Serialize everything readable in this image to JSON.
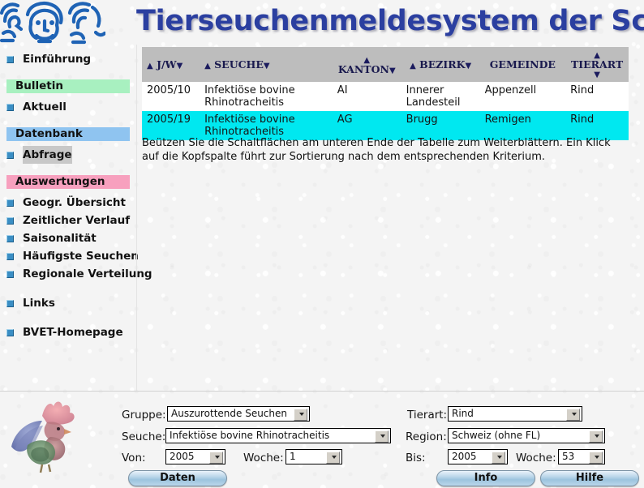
{
  "header": {
    "title": "Tierseuchenmeldesystem der Schweiz",
    "logo_icon": "three-animal-faces-logo"
  },
  "sidebar": {
    "items": [
      {
        "type": "link",
        "label": "Einführung",
        "name": "einfuehrung"
      },
      {
        "type": "section",
        "label": "Bulletin",
        "name": "bulletin",
        "color": "#a8f0c0"
      },
      {
        "type": "link",
        "label": "Aktuell",
        "name": "aktuell"
      },
      {
        "type": "section",
        "label": "Datenbank",
        "name": "datenbank",
        "color": "#8fc4f0"
      },
      {
        "type": "link",
        "label": "Abfrage",
        "name": "abfrage",
        "current": true
      },
      {
        "type": "section",
        "label": "Auswertungen",
        "name": "auswertungen",
        "color": "#f7a0be"
      },
      {
        "type": "link",
        "label": "Geogr. Übersicht",
        "name": "geogr-uebersicht"
      },
      {
        "type": "link",
        "label": "Zeitlicher Verlauf",
        "name": "zeitlicher-verlauf"
      },
      {
        "type": "link",
        "label": "Saisonalität",
        "name": "saisonalitaet"
      },
      {
        "type": "link",
        "label": "Häufigste Seuchen",
        "name": "haeufigste-seuchen"
      },
      {
        "type": "link",
        "label": "Regionale Verteilung",
        "name": "regionale-verteilung"
      },
      {
        "type": "link",
        "label": "Links",
        "name": "links"
      },
      {
        "type": "link",
        "label": "BVET-Homepage",
        "name": "bvet-homepage"
      }
    ]
  },
  "table": {
    "columns": [
      {
        "label": "J/W",
        "sort_up": "▲",
        "sort_down": "▼",
        "layout": "inline",
        "name": "jw"
      },
      {
        "label": "SEUCHE",
        "sort_up": "▲",
        "sort_down": "▼",
        "layout": "inline",
        "name": "seuche"
      },
      {
        "label": "KANTON",
        "sort_up": "▲",
        "sort_down": "▼",
        "layout": "above",
        "name": "kanton"
      },
      {
        "label": "BEZIRK",
        "sort_up": "▲",
        "sort_down": "▼",
        "layout": "inline",
        "name": "bezirk"
      },
      {
        "label": "GEMEINDE",
        "sort_up": "",
        "sort_down": "",
        "layout": "plain",
        "name": "gemeinde"
      },
      {
        "label": "TIERART",
        "sort_up": "▲",
        "sort_down": "▼",
        "layout": "stacked",
        "name": "tierart"
      }
    ],
    "rows": [
      {
        "jw": "2005/10",
        "seuche": "Infektiöse bovine Rhinotracheitis",
        "kanton": "AI",
        "bezirk": "Innerer Landesteil",
        "gemeinde": "Appenzell",
        "tierart": "Rind",
        "highlight": false
      },
      {
        "jw": "2005/19",
        "seuche": "Infektiöse bovine Rhinotracheitis",
        "kanton": "AG",
        "bezirk": "Brugg",
        "gemeinde": "Remigen",
        "tierart": "Rind",
        "highlight": true
      }
    ],
    "note": "Beützen Sie die Schaltflächen am unteren Ende der Tabelle zum Weiterblättern. Ein Klick auf die Kopfspalte führt zur Sortierung nach dem entsprechenden Kriterium.",
    "header_bg": "#bdbdbd",
    "highlight_bg": "#00e8f0"
  },
  "footer": {
    "rooster_icon": "rooster-watercolor-image",
    "fields": {
      "gruppe_label": "Gruppe:",
      "gruppe_value": "Auszurottende Seuchen",
      "seuche_label": "Seuche:",
      "seuche_value": "Infektiöse bovine Rhinotracheitis",
      "von_label": "Von:",
      "von_value": "2005",
      "von_woche_label": "Woche:",
      "von_woche_value": "1",
      "tierart_label": "Tierart:",
      "tierart_value": "Rind",
      "region_label": "Region:",
      "region_value": "Schweiz (ohne FL)",
      "bis_label": "Bis:",
      "bis_value": "2005",
      "bis_woche_label": "Woche:",
      "bis_woche_value": "53"
    },
    "buttons": {
      "daten": "Daten",
      "info": "Info",
      "hilfe": "Hilfe"
    }
  }
}
